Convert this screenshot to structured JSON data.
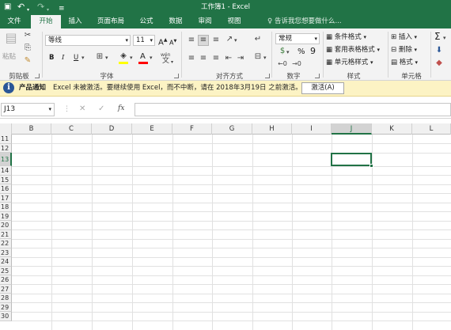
{
  "title_bar": {
    "title": "工作簿1 - Excel",
    "save_icon": "save-icon",
    "undo_icon": "undo-icon",
    "redo_icon": "redo-icon"
  },
  "tabs": [
    "文件",
    "开始",
    "插入",
    "页面布局",
    "公式",
    "数据",
    "审阅",
    "视图"
  ],
  "active_tab": "开始",
  "tell_me": "告诉我您想要做什么...",
  "ribbon": {
    "clipboard": {
      "paste": "粘贴",
      "label": "剪贴板"
    },
    "font": {
      "name": "等线",
      "size": "11",
      "bold": "B",
      "italic": "I",
      "underline": "U",
      "grow": "A",
      "shrink": "A",
      "color_letter": "A",
      "label": "字体",
      "wen": "wén",
      "highlight_color": "#ffff00",
      "font_color": "#ff0000"
    },
    "alignment": {
      "label": "对齐方式"
    },
    "number": {
      "format": "常规",
      "percent": "%",
      "comma": "9",
      "label": "数字"
    },
    "styles": {
      "conditional": "条件格式",
      "table": "套用表格格式",
      "cell": "单元格样式",
      "label": "样式"
    },
    "cells": {
      "insert": "插入",
      "delete": "删除",
      "format": "格式",
      "label": "单元格"
    },
    "editing": {
      "sum": "Σ"
    }
  },
  "message_bar": {
    "title": "产品通知",
    "text": "Excel 未被激活。要继续使用 Excel，而不中断，请在 2018年3月19日 之前激活。",
    "button": "激活(A)"
  },
  "formula_bar": {
    "name_box": "J13",
    "fx": "fx",
    "cancel": "✕",
    "enter": "✓"
  },
  "grid": {
    "columns": [
      "B",
      "C",
      "D",
      "E",
      "F",
      "G",
      "H",
      "I",
      "J",
      "K",
      "L"
    ],
    "rows": [
      "11",
      "12",
      "13",
      "14",
      "15",
      "16",
      "17",
      "18",
      "19",
      "20",
      "21",
      "22",
      "23",
      "24",
      "25",
      "26",
      "27",
      "28",
      "29",
      "30"
    ],
    "selected_cell": "J13",
    "accent": "#217346"
  }
}
